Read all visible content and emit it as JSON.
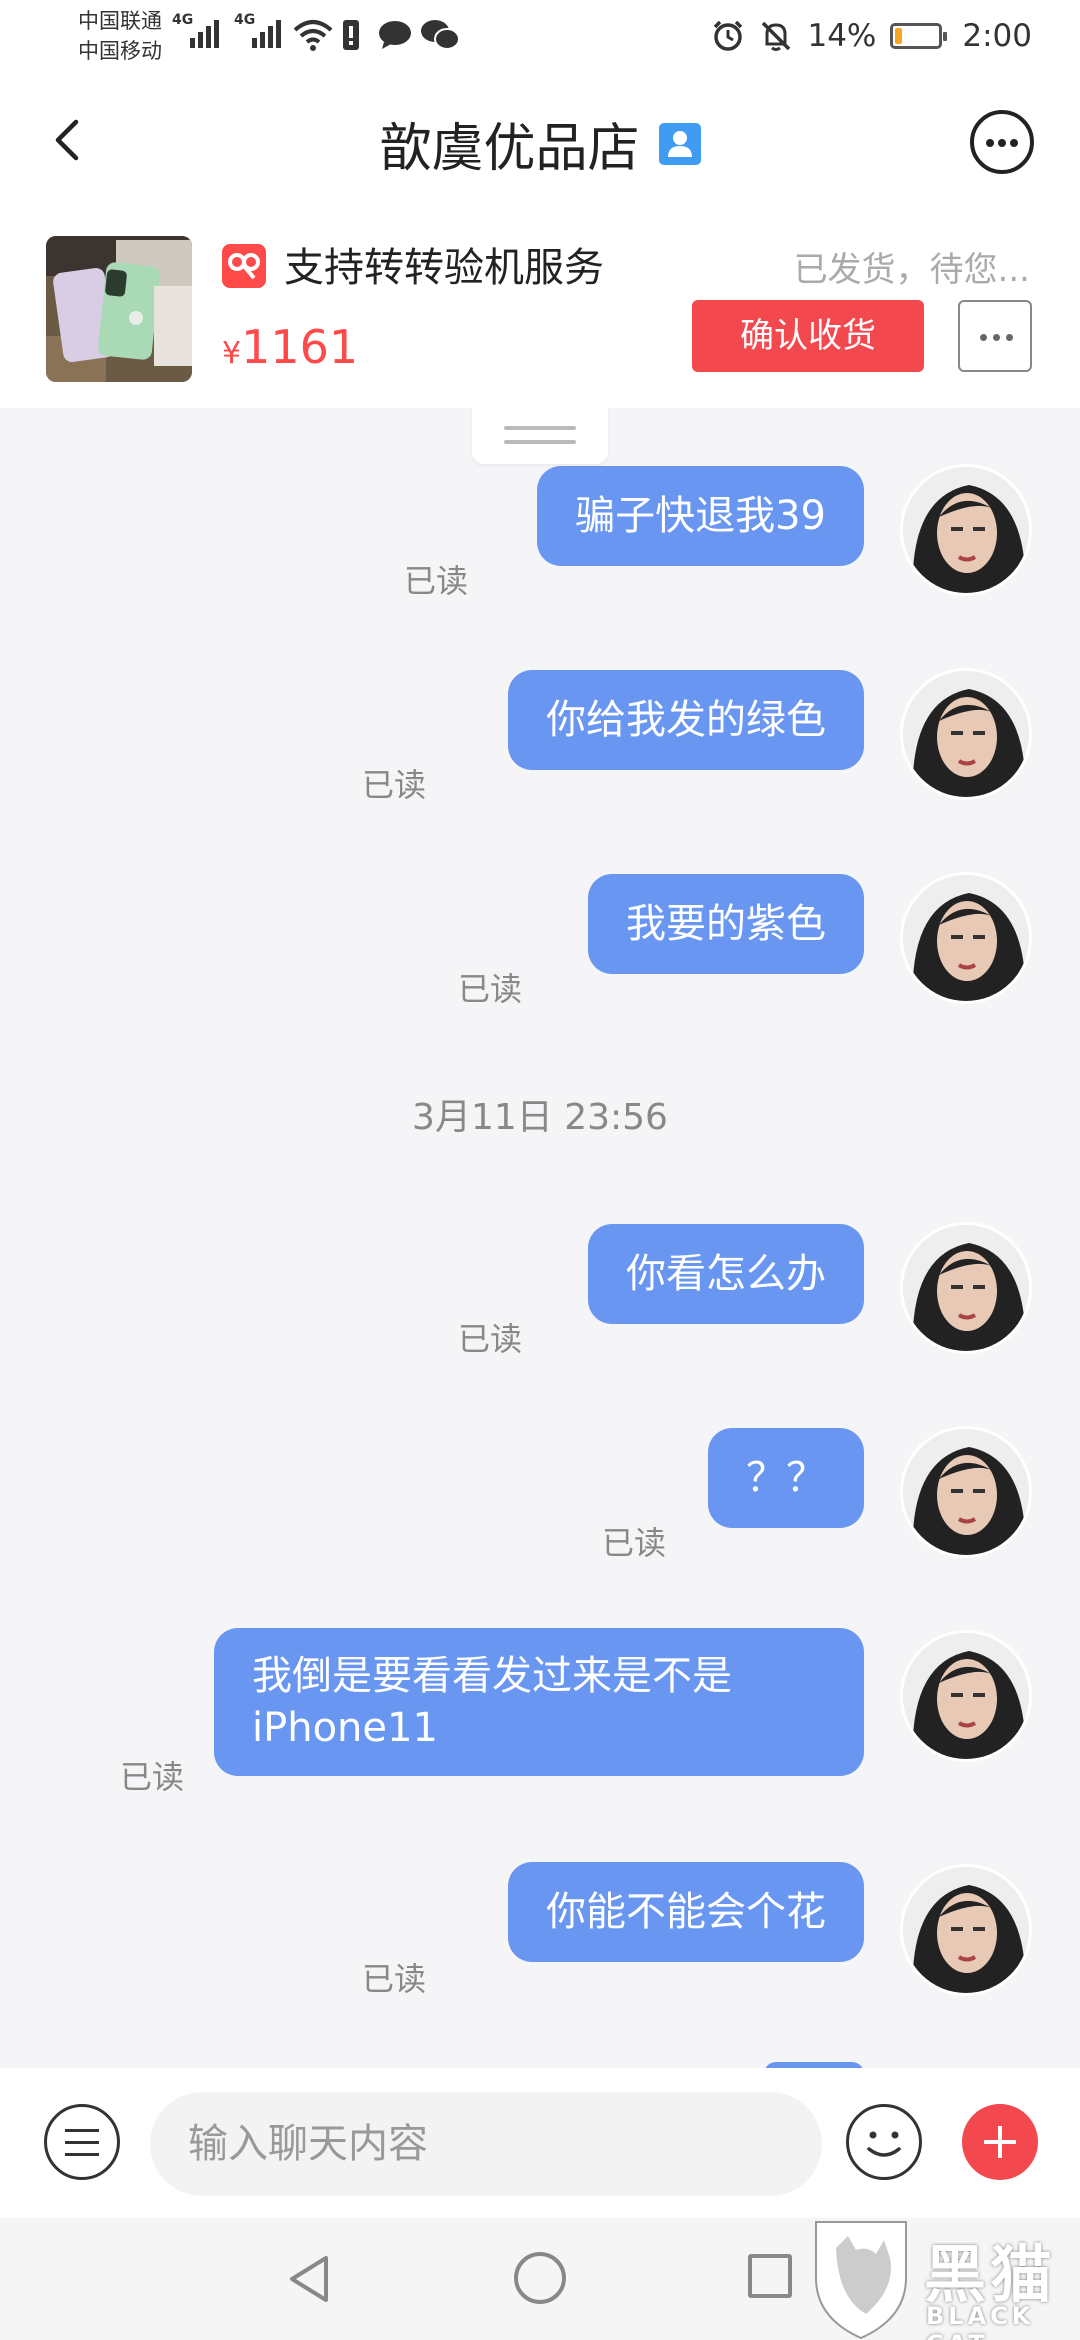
{
  "status_bar": {
    "carrier1": "中国联通",
    "carrier2": "中国移动",
    "net1": "4G",
    "net2": "4G",
    "battery_percent": "14%",
    "battery_level": 0.14,
    "time": "2:00"
  },
  "header": {
    "title": "歆虞优品店"
  },
  "product": {
    "service_text": "支持转转验机服务",
    "currency": "¥",
    "price": "1161",
    "order_status": "已发货，待您...",
    "confirm_button": "确认收货"
  },
  "chat": {
    "read_label": "已读",
    "messages_group1": [
      {
        "text": "骗子快退我39",
        "read": "已读"
      },
      {
        "text": "你给我发的绿色",
        "read": "已读"
      },
      {
        "text": "我要的紫色",
        "read": "已读"
      }
    ],
    "timestamp": "3月11日 23:56",
    "messages_group2": [
      {
        "text": "你看怎么办",
        "read": "已读"
      },
      {
        "text": "？？",
        "read": "已读"
      },
      {
        "text": "我倒是要看看发过来是不是iPhone11",
        "read": "已读"
      },
      {
        "text": "你能不能会个花",
        "read": "已读"
      }
    ]
  },
  "input": {
    "placeholder": "输入聊天内容"
  },
  "watermark": {
    "main": "黑猫",
    "sub": "BLACK CAT"
  },
  "colors": {
    "accent_red": "#f4484f",
    "bubble_blue": "#6996f0",
    "verified_blue": "#3f9cf2"
  }
}
